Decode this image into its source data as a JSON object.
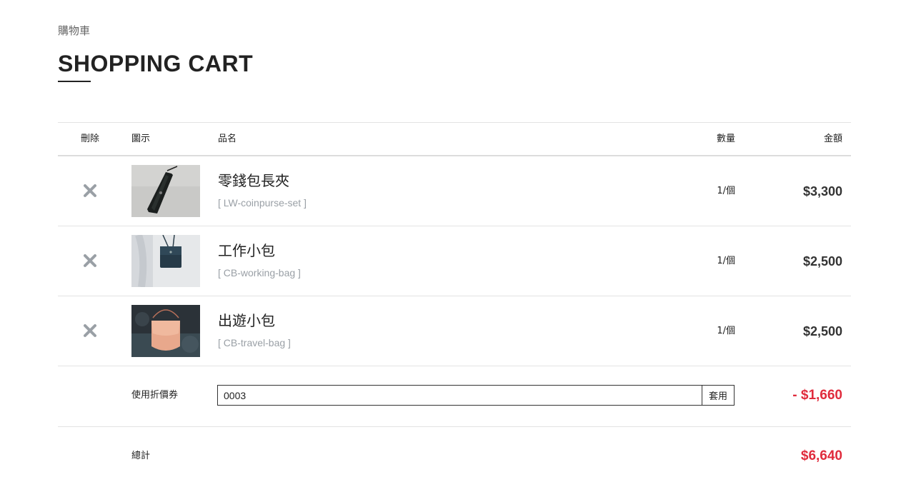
{
  "breadcrumb": "購物車",
  "page_title": "SHOPPING CART",
  "table": {
    "headers": {
      "delete": "刪除",
      "image": "圖示",
      "name": "品名",
      "qty": "數量",
      "amount": "金額"
    },
    "items": [
      {
        "name": "零錢包長夾",
        "sku": "[ LW-coinpurse-set ]",
        "qty": "1/個",
        "amount": "$3,300"
      },
      {
        "name": "工作小包",
        "sku": "[ CB-working-bag ]",
        "qty": "1/個",
        "amount": "$2,500"
      },
      {
        "name": "出遊小包",
        "sku": "[ CB-travel-bag ]",
        "qty": "1/個",
        "amount": "$2,500"
      }
    ]
  },
  "coupon": {
    "label": "使用折價券",
    "value": "0003",
    "apply_label": "套用",
    "discount": "- $1,660"
  },
  "total": {
    "label": "總計",
    "amount": "$6,640"
  },
  "colors": {
    "accent_red": "#e02b3c",
    "delete_icon": "#9aa0a6"
  }
}
